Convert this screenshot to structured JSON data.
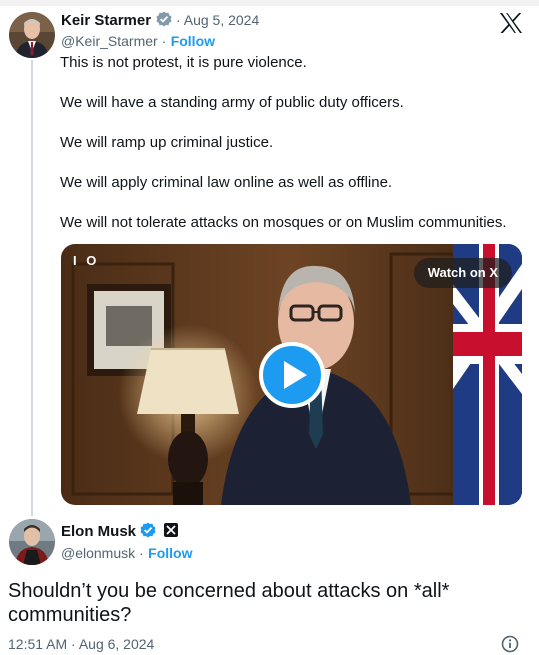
{
  "brand": {
    "x_logo_color": "#0f1419",
    "accent": "#1d9bf0"
  },
  "quoted_post": {
    "author_name": "Keir Starmer",
    "date": "· Aug 5, 2024",
    "handle": "@Keir_Starmer ·",
    "follow_label": "Follow",
    "paragraphs": [
      "This is not protest, it is pure violence.",
      "We will have a standing army of public duty officers.",
      "We will ramp up criminal justice.",
      "We will apply criminal law online as well as offline.",
      "We will not tolerate attacks on mosques or on Muslim communities."
    ],
    "video": {
      "watch_label": "Watch on X",
      "corner_label": "I O"
    }
  },
  "reply_post": {
    "author_name": "Elon Musk",
    "handle": "@elonmusk ·",
    "follow_label": "Follow",
    "text": "Shouldn’t you be concerned about attacks on *all* communities?",
    "timestamp": "12:51 AM · Aug 6, 2024"
  },
  "icons": [
    "x-logo-icon",
    "verified-gray-icon",
    "verified-blue-icon",
    "x-badge-icon",
    "play-icon",
    "info-icon"
  ]
}
